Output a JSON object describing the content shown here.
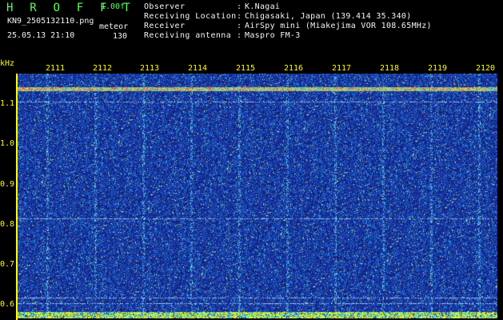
{
  "program": {
    "title": "H R O F F T",
    "version": "1.00f"
  },
  "image": {
    "filename": "KN9_2505132110.png",
    "label": "meteor",
    "datetime": "25.05.13 21:10",
    "count": "130"
  },
  "header_info": [
    {
      "label": "Observer",
      "sep": ":",
      "value": "K.Nagai"
    },
    {
      "label": "Receiving Location",
      "sep": ":",
      "value": "Chigasaki, Japan (139.414 35.340)"
    },
    {
      "label": "Receiver",
      "sep": ":",
      "value": "AirSpy mini (Miakejima VOR 108.65MHz)"
    },
    {
      "label": "Receiving antenna",
      "sep": ":",
      "value": "Maspro FM-3"
    }
  ],
  "spectrogram": {
    "y_unit": "kHz",
    "x_ticks": [
      "2111",
      "2112",
      "2113",
      "2114",
      "2115",
      "2116",
      "2117",
      "2118",
      "2119",
      "2120"
    ],
    "y_ticks": [
      "1.1",
      "1.0",
      "0.9",
      "0.8",
      "0.7",
      "0.6"
    ],
    "colors": {
      "label_yellow": "#ffff00",
      "label_green": "#5cff5c",
      "background": "#1e3aa8"
    }
  }
}
